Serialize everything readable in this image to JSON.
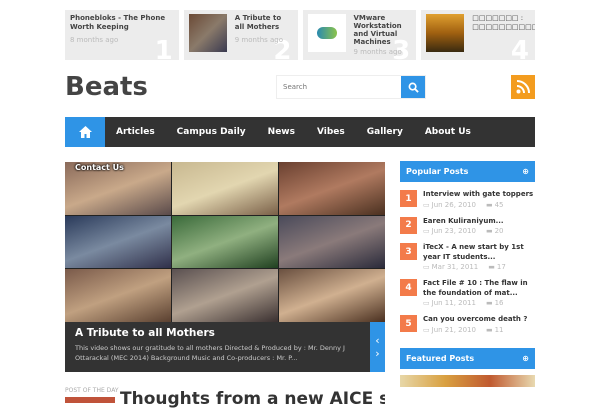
{
  "top_posts": [
    {
      "title": "Phonebloks - The Phone Worth Keeping",
      "ago": "8 months ago",
      "num": "1"
    },
    {
      "title": "A Tribute to all Mothers",
      "ago": "9 months ago",
      "num": "2"
    },
    {
      "title": "VMware Workstation and Virtual Machines",
      "ago": "9 months ago",
      "num": "3"
    },
    {
      "title": "□□□□□□□ : □□□□□□□□□□□",
      "ago": "",
      "num": "4"
    }
  ],
  "site": {
    "logo": "Beats",
    "search_placeholder": "Search"
  },
  "nav": [
    "Articles",
    "Campus Daily",
    "News",
    "Vibes",
    "Gallery",
    "About Us"
  ],
  "slider": {
    "overlay_menu": "Contact Us",
    "title": "A Tribute to all Mothers",
    "excerpt": "This video shows our gratitude to all mothers Directed & Produced by : Mr. Denny J Ottarackal (MEC 2014) Background Music and Co-producers : Mr. P...",
    "prev": "‹",
    "next": "›"
  },
  "post_of_day": {
    "label": "POST OF THE DAY",
    "title": "Thoughts from a new AICE student"
  },
  "popular": {
    "title": "Popular Posts",
    "items": [
      {
        "n": "1",
        "title": "Interview with gate toppers",
        "date": "Jun 26, 2010",
        "comments": "45"
      },
      {
        "n": "2",
        "title": "Earen Kuliraniyum...",
        "date": "Jun 23, 2010",
        "comments": "20"
      },
      {
        "n": "3",
        "title": "iTecX - A new start by 1st year IT students...",
        "date": "Mar 31, 2011",
        "comments": "17"
      },
      {
        "n": "4",
        "title": "Fact File # 10 : The flaw in the foundation of mat...",
        "date": "Jun 11, 2011",
        "comments": "16"
      },
      {
        "n": "5",
        "title": "Can you overcome death ?",
        "date": "Jun 21, 2010",
        "comments": "11"
      }
    ]
  },
  "featured": {
    "title": "Featured Posts"
  }
}
